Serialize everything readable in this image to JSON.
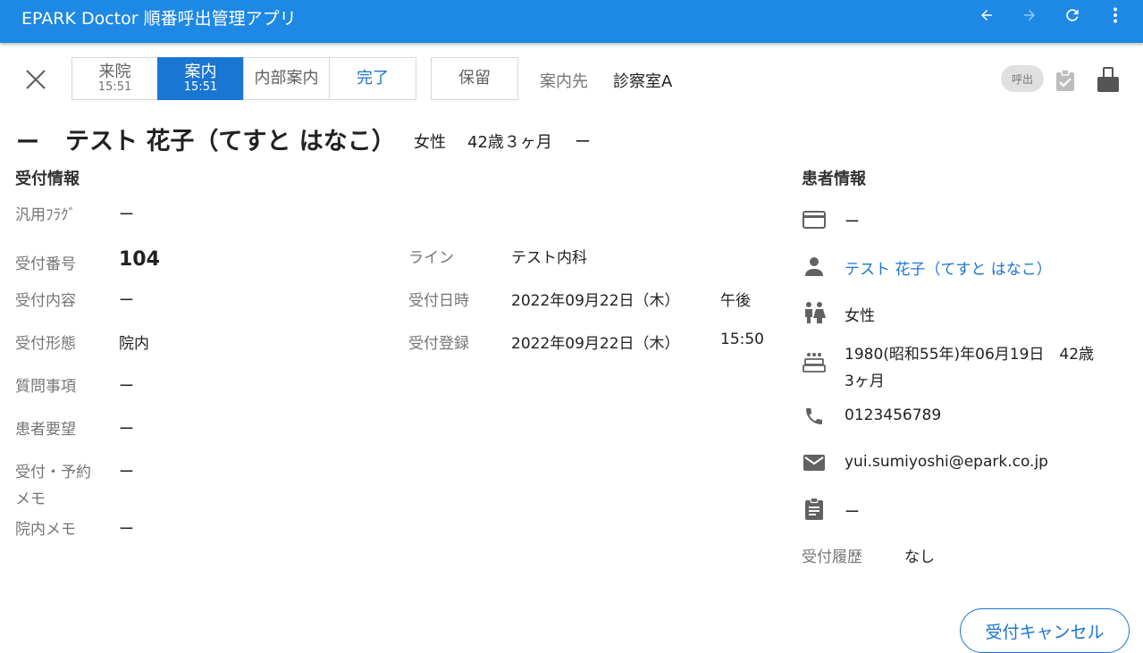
{
  "app": {
    "title": "EPARK Doctor 順番呼出管理アプリ",
    "accent": "#1e88e5",
    "icons": [
      "arrow-back-icon",
      "arrow-forward-icon",
      "refresh-icon",
      "more-vert-icon"
    ]
  },
  "toolbar": {
    "close_icon": "close-icon",
    "status": [
      {
        "label": "来院",
        "time": "15:51"
      },
      {
        "label": "案内",
        "time": "15:51"
      },
      {
        "label": "内部案内"
      },
      {
        "label": "完了"
      }
    ],
    "hold_label": "保留",
    "destination_label": "案内先",
    "destination_value": "診察室A",
    "call_label": "呼出"
  },
  "patient_header": {
    "prefix": "ー",
    "name": "テスト 花子（てすと はなこ）",
    "gender": "女性",
    "age": "42歳３ヶ月",
    "suffix": "ー"
  },
  "reception": {
    "title": "受付情報",
    "flag_label": "汎用ﾌﾗｸﾞ",
    "flag_value": "ー",
    "number_label": "受付番号",
    "number_value": "104",
    "content_label": "受付内容",
    "content_value": "ー",
    "form_label": "受付形態",
    "form_value": "院内",
    "question_label": "質問事項",
    "question_value": "ー",
    "request_label": "患者要望",
    "request_value": "ー",
    "memo_label_1": "受付・予約",
    "memo_label_2": "メモ",
    "memo_value": "ー",
    "internal_memo_label": "院内メモ",
    "internal_memo_value": "ー",
    "line_label": "ライン",
    "line_value": "テスト内科",
    "datetime_label": "受付日時",
    "datetime_value": "2022年09月22日（木）",
    "datetime_time": "午後",
    "registered_label": "受付登録",
    "registered_value": "2022年09月22日（木）",
    "registered_time": "15:50"
  },
  "patient": {
    "title": "患者情報",
    "card": "ー",
    "name": "テスト 花子（てすと はなこ）",
    "gender": "女性",
    "birthday_line1": "1980(昭和55年)年06月19日　42歳",
    "birthday_line2": "3ヶ月",
    "phone": "0123456789",
    "email": "yui.sumiyoshi@epark.co.jp",
    "clipboard": "ー",
    "history_label": "受付履歴",
    "history_value": "なし",
    "link_color": "#1976d2"
  },
  "footer": {
    "cancel_label": "受付キャンセル"
  }
}
